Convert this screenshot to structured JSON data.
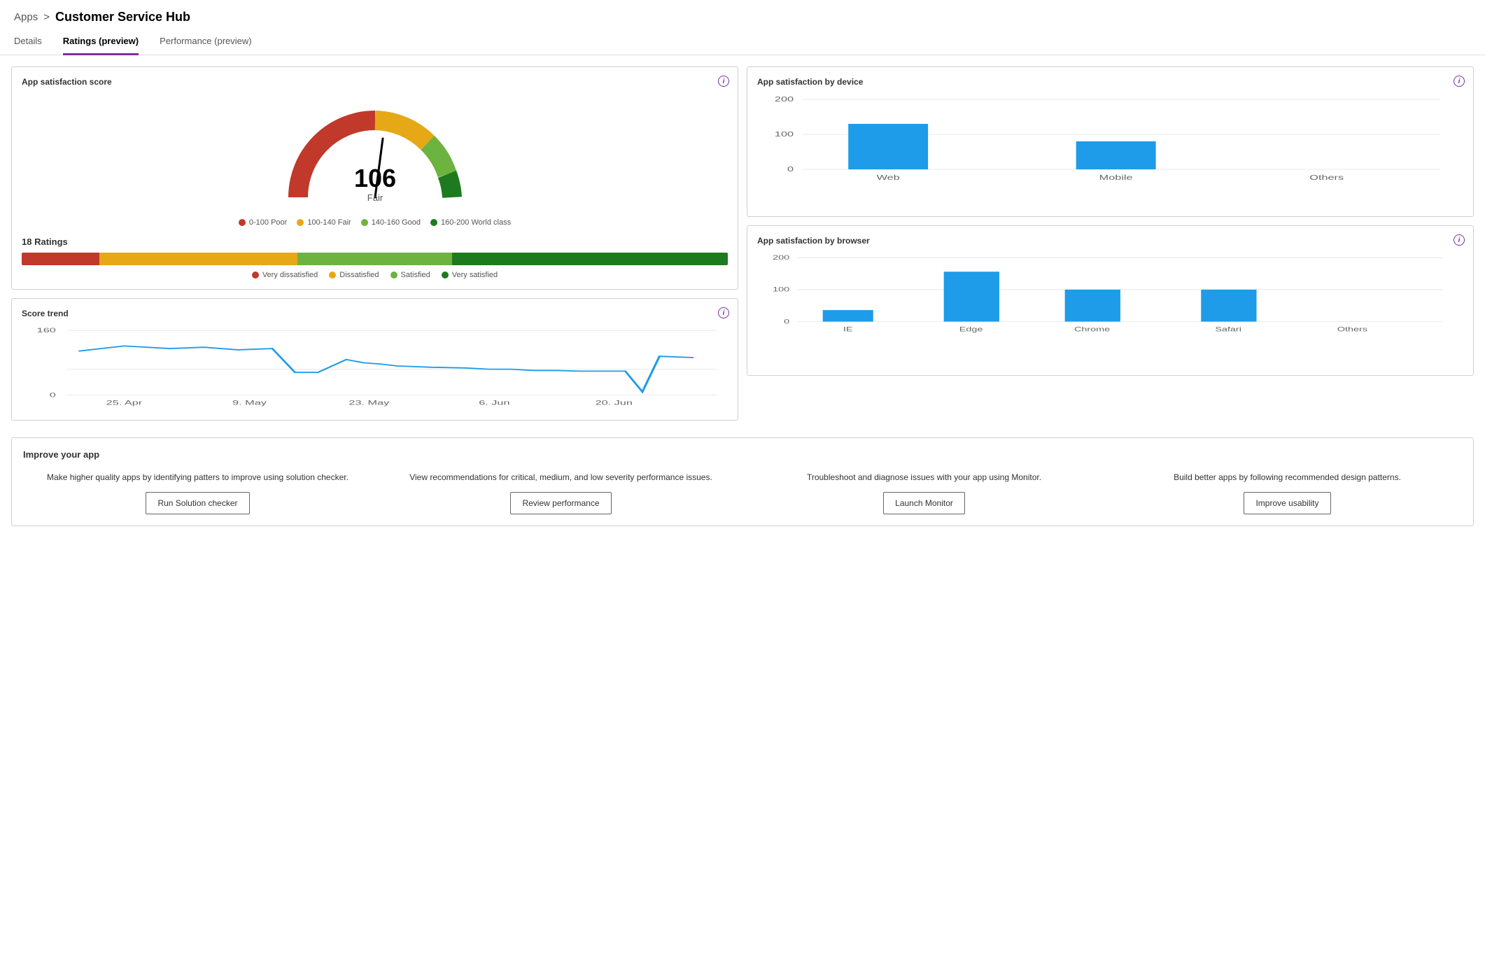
{
  "breadcrumb": {
    "apps_label": "Apps",
    "separator": ">",
    "title": "Customer Service Hub"
  },
  "tabs": [
    {
      "id": "details",
      "label": "Details",
      "active": false
    },
    {
      "id": "ratings",
      "label": "Ratings (preview)",
      "active": true
    },
    {
      "id": "performance",
      "label": "Performance (preview)",
      "active": false
    }
  ],
  "app_satisfaction_score": {
    "title": "App satisfaction score",
    "score": "106",
    "score_label": "Fair",
    "legend": [
      {
        "label": "0-100 Poor",
        "color": "#c0392b"
      },
      {
        "label": "100-140 Fair",
        "color": "#e6a817"
      },
      {
        "label": "140-160 Good",
        "color": "#6db33f"
      },
      {
        "label": "160-200 World class",
        "color": "#1e7a1e"
      }
    ],
    "ratings_count": "18 Ratings",
    "ratings_bar": [
      {
        "label": "Very dissatisfied",
        "color": "#c0392b",
        "pct": 11
      },
      {
        "label": "Dissatisfied",
        "color": "#e6a817",
        "pct": 28
      },
      {
        "label": "Satisfied",
        "color": "#6db33f",
        "pct": 22
      },
      {
        "label": "Very satisfied",
        "color": "#1e7a1e",
        "pct": 39
      }
    ]
  },
  "score_trend": {
    "title": "Score trend",
    "y_labels": [
      "160",
      "0"
    ],
    "x_labels": [
      "25. Apr",
      "9. May",
      "23. May",
      "6. Jun",
      "20. Jun"
    ],
    "y_tick_160": 160,
    "y_tick_0": 0
  },
  "app_satisfaction_device": {
    "title": "App satisfaction by device",
    "y_labels": [
      "200",
      "100",
      "0"
    ],
    "bars": [
      {
        "label": "Web",
        "value": 130,
        "color": "#1e9be9"
      },
      {
        "label": "Mobile",
        "value": 80,
        "color": "#1e9be9"
      },
      {
        "label": "Others",
        "value": 0,
        "color": "#1e9be9"
      }
    ],
    "max": 200
  },
  "app_satisfaction_browser": {
    "title": "App satisfaction by browser",
    "y_labels": [
      "200",
      "100",
      "0"
    ],
    "bars": [
      {
        "label": "IE",
        "value": 35,
        "color": "#1e9be9"
      },
      {
        "label": "Edge",
        "value": 155,
        "color": "#1e9be9"
      },
      {
        "label": "Chrome",
        "value": 100,
        "color": "#1e9be9"
      },
      {
        "label": "Safari",
        "value": 100,
        "color": "#1e9be9"
      },
      {
        "label": "Others",
        "value": 0,
        "color": "#1e9be9"
      }
    ],
    "max": 200
  },
  "improve_app": {
    "title": "Improve your app",
    "items": [
      {
        "desc": "Make higher quality apps by identifying patters to improve using solution checker.",
        "button": "Run Solution checker"
      },
      {
        "desc": "View recommendations for critical, medium, and low severity performance issues.",
        "button": "Review performance"
      },
      {
        "desc": "Troubleshoot and diagnose issues with your app using Monitor.",
        "button": "Launch Monitor"
      },
      {
        "desc": "Build better apps by following recommended design patterns.",
        "button": "Improve usability"
      }
    ]
  }
}
